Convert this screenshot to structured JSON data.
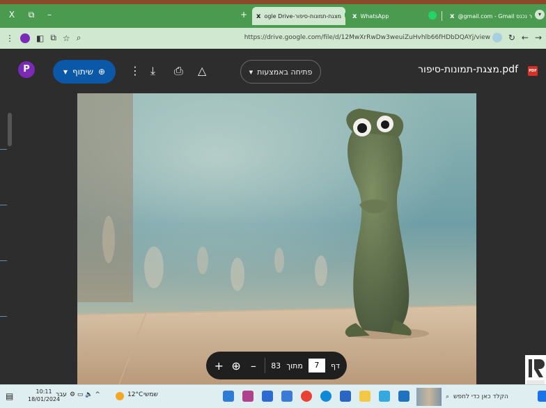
{
  "window": {
    "close_label": "X",
    "restore_label": "⧉",
    "minimize_label": "–"
  },
  "tabs": [
    {
      "label": "ogle Drive-מצגת-תמונות-סיפור",
      "close": "x",
      "active": true
    },
    {
      "label": "WhatsApp",
      "close": "x",
      "active": false
    },
    {
      "label": "@gmail.com - Gmail דואר נכנס",
      "close": "x",
      "active": false
    }
  ],
  "new_tab_label": "+",
  "address": {
    "url": "https://drive.google.com/file/d/12MwXrRwDw3weuiZuHvhlb66fHDbDQAYj/view"
  },
  "viewer": {
    "avatar_letter": "P",
    "share_label": "שיתוף",
    "open_with_label": "פתיחה באמצעות",
    "file_title": "מצגת-תמונות-סיפור.pdf",
    "pdf_badge": "PDF"
  },
  "pagenav": {
    "page_word": "דף",
    "current_page": "7",
    "of_word": "מתוך",
    "total_pages": "83",
    "zoom_out": "–",
    "zoom_in": "+"
  },
  "taskbar": {
    "time": "10:11",
    "date": "18/01/2024",
    "lang": "עבר",
    "weather_temp": "12°C",
    "weather_desc": "שמשי",
    "search_placeholder": "הקלד כאן כדי לחפש"
  },
  "colors": {
    "tabstrip": "#4a9b4f",
    "addrbar": "#cfe8cf",
    "viewer_bg": "#2d2d2d",
    "share_button": "#0b57a8",
    "avatar": "#7b2ab8"
  }
}
